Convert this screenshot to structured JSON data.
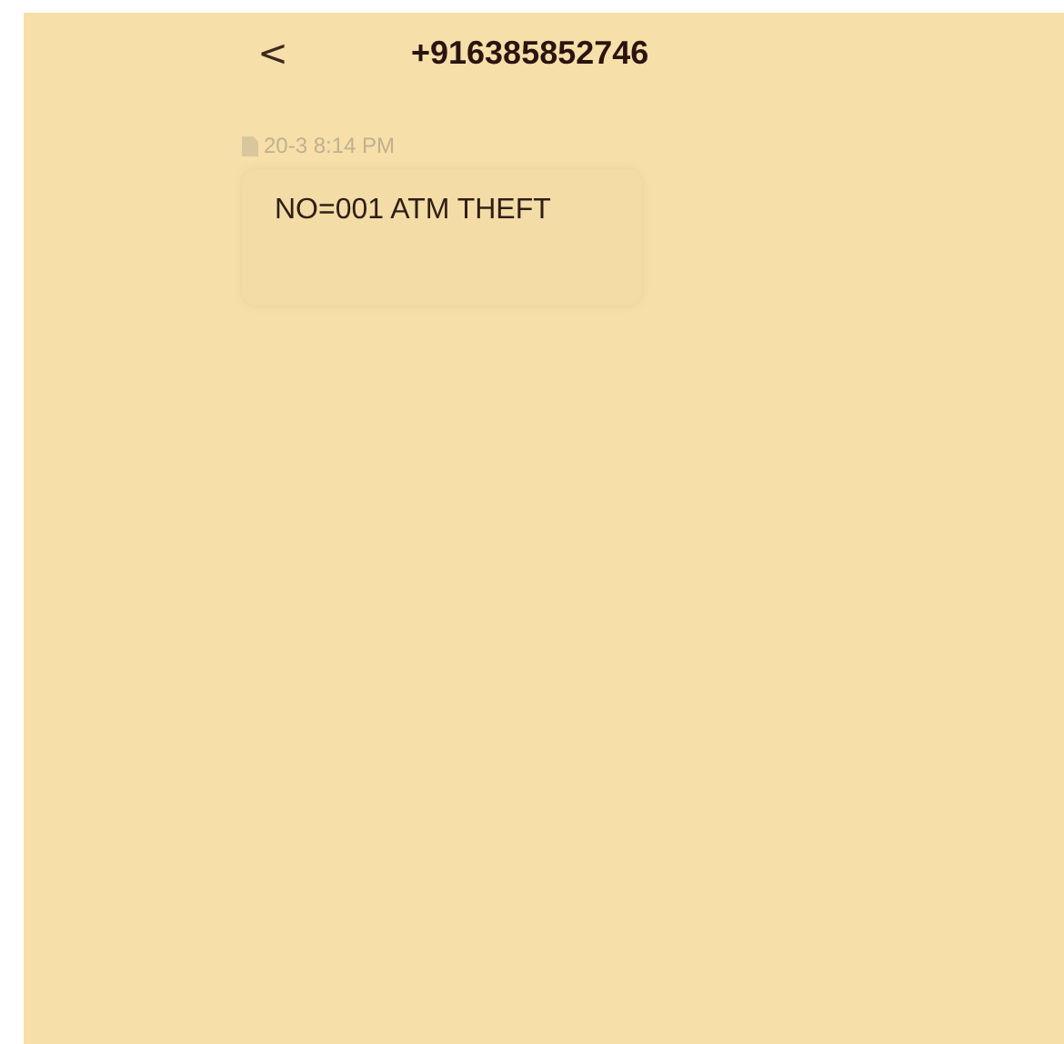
{
  "header": {
    "back_icon": "<",
    "title": "+916385852746"
  },
  "messages": [
    {
      "timestamp": "20-3 8:14 PM",
      "text": "NO=001 ATM THEFT"
    }
  ]
}
